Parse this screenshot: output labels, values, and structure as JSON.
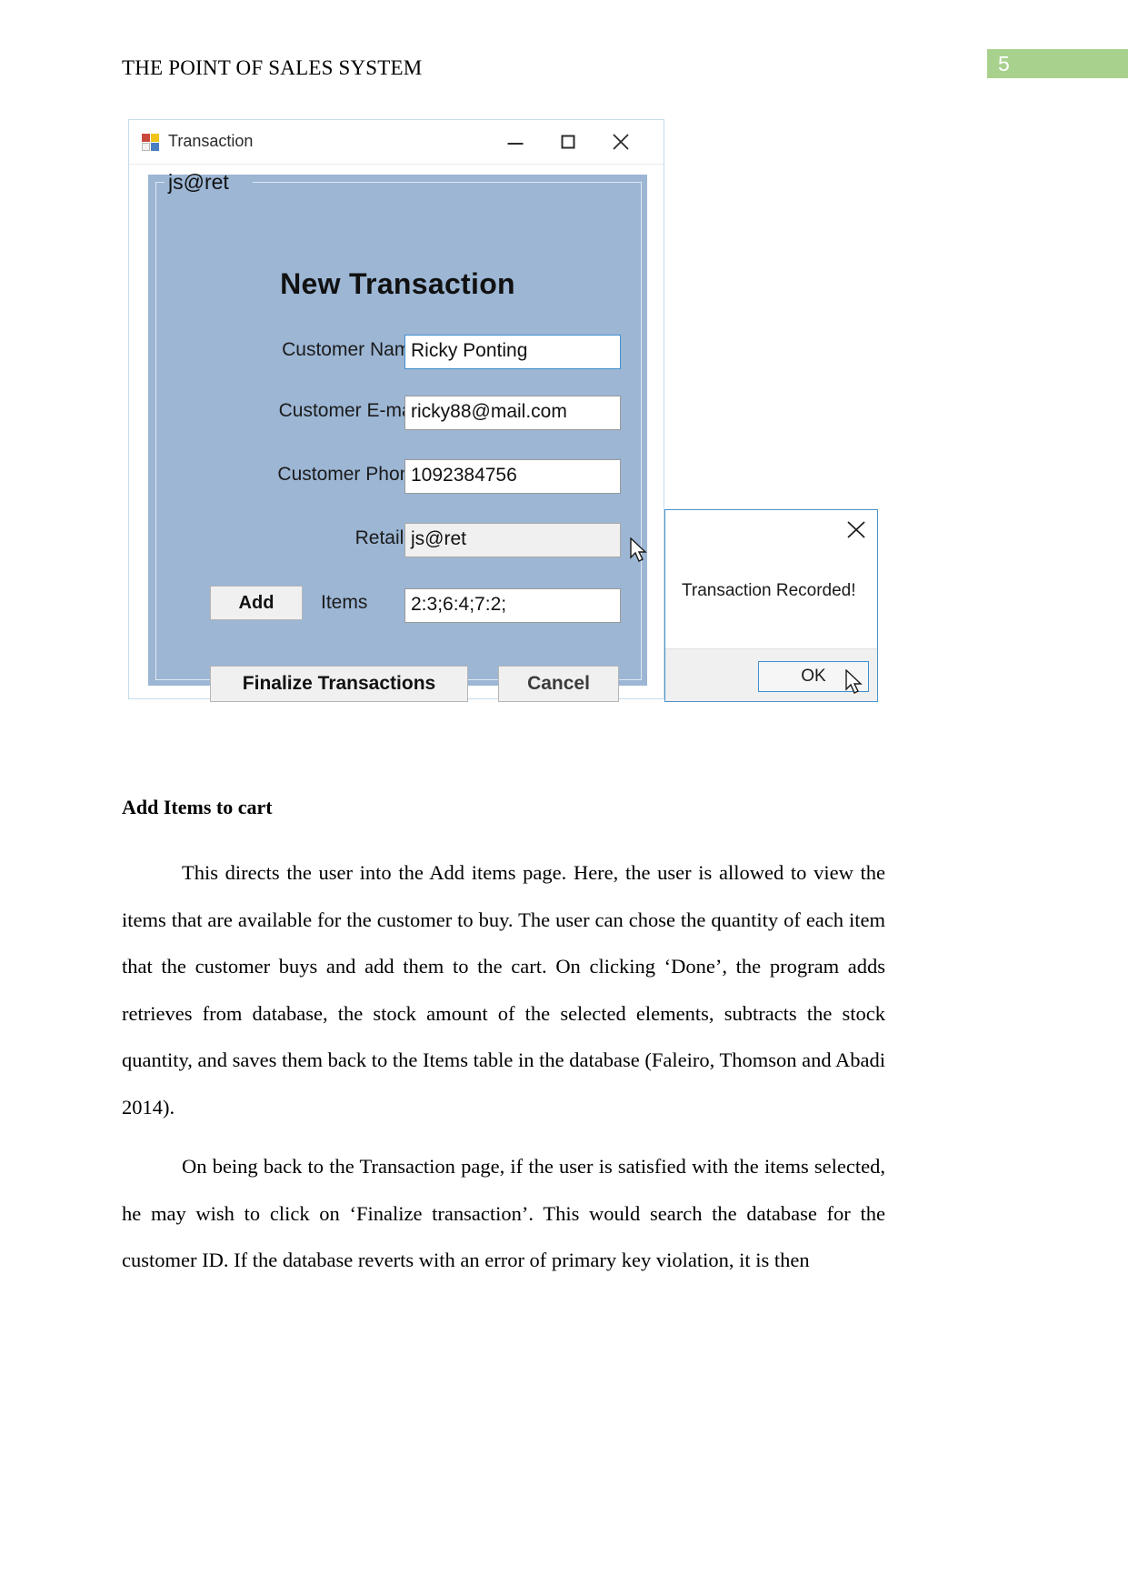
{
  "document": {
    "running_head": "THE POINT OF SALES SYSTEM",
    "page_number": "5",
    "page_number_band_color": "#a9d18e",
    "section_heading": "Add Items to cart",
    "paragraphs": [
      "This directs the user into the Add items page. Here, the user is allowed to view the items that are available for the customer to buy. The user can chose the quantity of each item that the customer buys and add them to the cart. On clicking ‘Done’, the program adds retrieves from database, the stock amount of the selected elements, subtracts the stock quantity, and saves them back to the Items table in the database (Faleiro, Thomson and Abadi 2014).",
      "On being back to the Transaction page, if the user is satisfied with the items selected, he may wish to click on ‘Finalize transaction’. This would search the database for the customer ID. If the database reverts with an error of primary key violation, it is then"
    ]
  },
  "screenshot": {
    "window": {
      "title": "Transaction",
      "icon": "winforms-app-icon",
      "controls": {
        "minimize": "minimize-icon",
        "maximize": "maximize-icon",
        "close": "close-icon"
      },
      "panel": {
        "group_label": "js@ret",
        "background_color": "#9cb6d4",
        "form_title": "New Transaction",
        "fields": [
          {
            "label": "Customer Name",
            "value": "Ricky Ponting",
            "state": "focused"
          },
          {
            "label": "Customer E-mail",
            "value": "ricky88@mail.com",
            "state": "normal"
          },
          {
            "label": "Customer Phone",
            "value": "1092384756",
            "state": "normal"
          },
          {
            "label": "Retailer",
            "value": "js@ret",
            "state": "disabled"
          }
        ],
        "items_row": {
          "add_button": "Add",
          "label": "Items",
          "value": "2:3;6:4;7:2;"
        },
        "actions": {
          "finalize": "Finalize Transactions",
          "cancel": "Cancel"
        }
      }
    },
    "dialog": {
      "message": "Transaction Recorded!",
      "ok_button": "OK",
      "close_icon": "close-icon",
      "accent_color": "#3f8fd0"
    }
  }
}
